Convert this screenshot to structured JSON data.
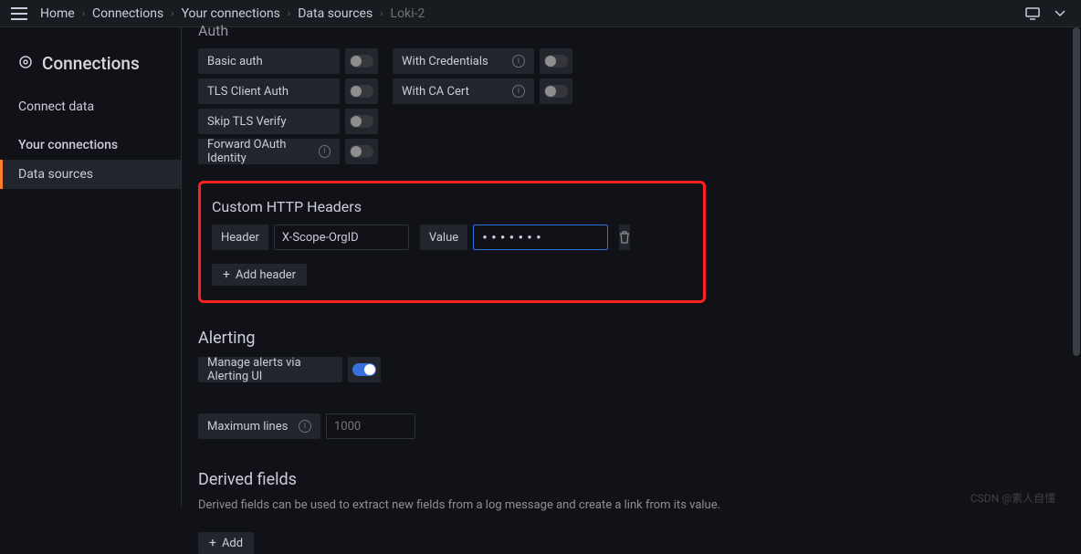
{
  "breadcrumb": {
    "items": [
      "Home",
      "Connections",
      "Your connections",
      "Data sources"
    ],
    "current": "Loki-2"
  },
  "sidebar": {
    "title": "Connections",
    "items": [
      {
        "label": "Connect data",
        "active": false
      },
      {
        "label": "Your connections",
        "active": false,
        "section": true
      },
      {
        "label": "Data sources",
        "active": true
      }
    ]
  },
  "auth": {
    "title": "Auth",
    "rows": [
      {
        "left": "Basic auth",
        "right": "With Credentials",
        "rightInfo": true
      },
      {
        "left": "TLS Client Auth",
        "right": "With CA Cert",
        "rightInfo": true
      },
      {
        "left": "Skip TLS Verify"
      },
      {
        "left": "Forward OAuth Identity",
        "leftInfo": true
      }
    ]
  },
  "customHeaders": {
    "title": "Custom HTTP Headers",
    "headerLabel": "Header",
    "headerValue": "X-Scope-OrgID",
    "valueLabel": "Value",
    "valueMasked": "•••••••",
    "addBtn": "Add header"
  },
  "alerting": {
    "title": "Alerting",
    "manageLabel": "Manage alerts via Alerting UI",
    "maxLinesLabel": "Maximum lines",
    "maxLinesPlaceholder": "1000"
  },
  "derived": {
    "title": "Derived fields",
    "desc": "Derived fields can be used to extract new fields from a log message and create a link from its value.",
    "addBtn": "Add"
  },
  "watermark": "CSDN @素人自懂"
}
